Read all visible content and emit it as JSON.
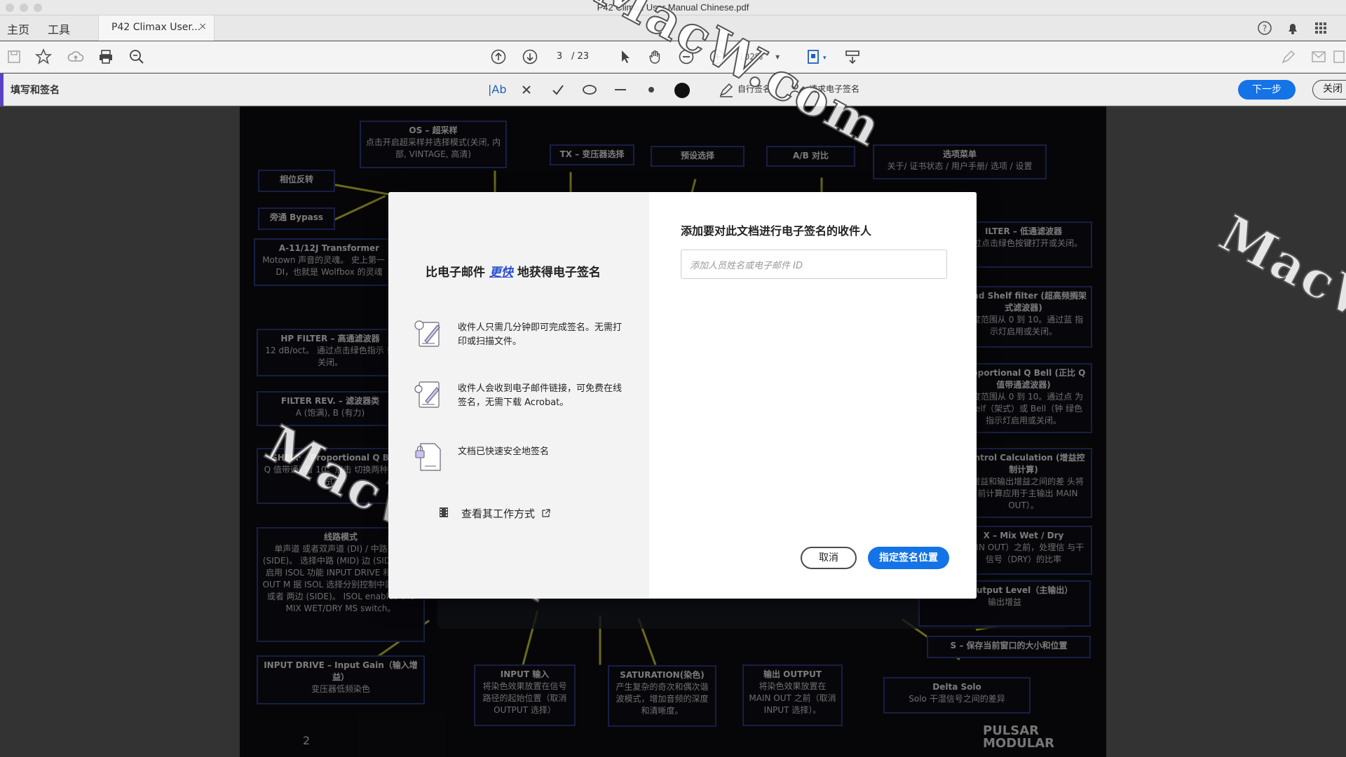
{
  "window": {
    "title": "P42 Climax User Manual Chinese.pdf"
  },
  "menu": {
    "home": "主页",
    "tools": "工具"
  },
  "tab": {
    "label": "P42 Climax User...",
    "close": "×"
  },
  "toolbar": {
    "page_current": "3",
    "page_total": "/ 23",
    "zoom": "102%"
  },
  "signbar": {
    "title": "填写和签名",
    "text_tool": "|Ab",
    "self_sign": "自行签名",
    "request_sign": "请求电子签名",
    "next": "下一步",
    "close": "关闭"
  },
  "document": {
    "page_number": "2",
    "brand_line1": "PULSAR",
    "brand_line2": "MODULAR",
    "watermark": "MacW.com",
    "annotations": {
      "os_title": "OS – 超采样",
      "os_body": "点击开启超采样并选择模式(关闭, 内部, VINTAGE, 高清)",
      "tx_title": "TX – 变压器选择",
      "preset_title": "预设选择",
      "ab_title": "A/B 对比",
      "options_title": "选项菜单",
      "options_body": "关于/ 证书状态 / 用户手册/ 选项 / 设置",
      "phase_title": "相位反转",
      "bypass_title": "旁通 Bypass",
      "transformer_title": "A-11/12J Transformer",
      "transformer_body": "Motown 声音的灵魂。 史上第一 式 DI，也就是 Wolfbox 的灵魂",
      "hp_title": "HP FILTER – 高通滤波器",
      "hp_body": "12 dB/oct。 通过点击绿色指示 或关闭。",
      "filterrev_title": "FILTER REV. – 滤波器类",
      "filterrev_body": "A (饱满), B (有力)",
      "shelf_title": "SHELF / Proportional Q B",
      "shelf_body": "Q 值带通) 增 10。点击 切换两种模式",
      "routing_title": "线路模式",
      "routing_body": "单声道 或者双声道 (DI) / 中路 两边 (SIDE)。 选择中路 (MID) 边 (SIDE) 能即启用 ISOL 功能 INPUT DRIVE 和 MAIN OUT M 据 ISOL 选择分别控制中路 (MID) 或者 两边 (SIDE)。 ISOL enables the MIX WET/DRY MS switch。",
      "inputdrive_title": "INPUT DRIVE – Input Gain（输入增益）",
      "inputdrive_body": "变压器低频染色",
      "input_title": "INPUT 输入",
      "input_body": "将染色效果放置在信号路径的起始位置（取消 OUTPUT 选择）",
      "saturation_title": "SATURATION(染色)",
      "saturation_body": "产生复杂的奇次和偶次谐波模式，增加音频的深度和清晰度。",
      "output_title": "输出 OUTPUT",
      "output_body": "将染色效果放置在 MAIN OUT 之前（取消 INPUT 选择）。",
      "lpf_title": "ILTER – 低通滤波器",
      "lpf_body": "通过点击绿色按键打开或关闭。",
      "hishelf_title": "Band Shelf filter (超高频搁架式滤波器)",
      "hishelf_body": "幅度范围从 0 到 10。通过蓝 指示灯启用或关闭。",
      "bell_title": "Proportional Q Bell (正比 Q 值带通滤波器)",
      "bell_body": "幅度范围从 0 到 10。通过点 为 Shelf（架式）或 Bell（钟 绿色指示灯启用或关闭。",
      "gaincalc_title": "Control Calculation (增益控制计算)",
      "gaincalc_body": "入增益和输出增益之间的差 头将当前计算应用于主输出 MAIN OUT）。",
      "mix_title": "X – Mix Wet / Dry",
      "mix_body": "MAIN OUT）之前，处理信 与干信号（DRY）的比率",
      "mainout_title": "– Main Output Level（主输出）",
      "mainout_body": "输出增益",
      "save_title": "S – 保存当前窗口的大小和位置",
      "delta_title": "Delta Solo",
      "delta_body": "Solo 干湿信号之间的差异"
    }
  },
  "modal": {
    "headline_before": "比电子邮件",
    "headline_emph": "更快",
    "headline_after": "地获得电子签名",
    "features": [
      {
        "text": "收件人只需几分钟即可完成签名。无需打印或扫描文件。"
      },
      {
        "text": "收件人会收到电子邮件链接，可免费在线签名，无需下载 Acrobat。"
      },
      {
        "text": "文档已快速安全地签名"
      }
    ],
    "how_link": "查看其工作方式",
    "title": "添加要对此文档进行电子签名的收件人",
    "input_placeholder": "添加人员姓名或电子邮件 ID",
    "cancel": "取消",
    "assign": "指定签名位置"
  }
}
